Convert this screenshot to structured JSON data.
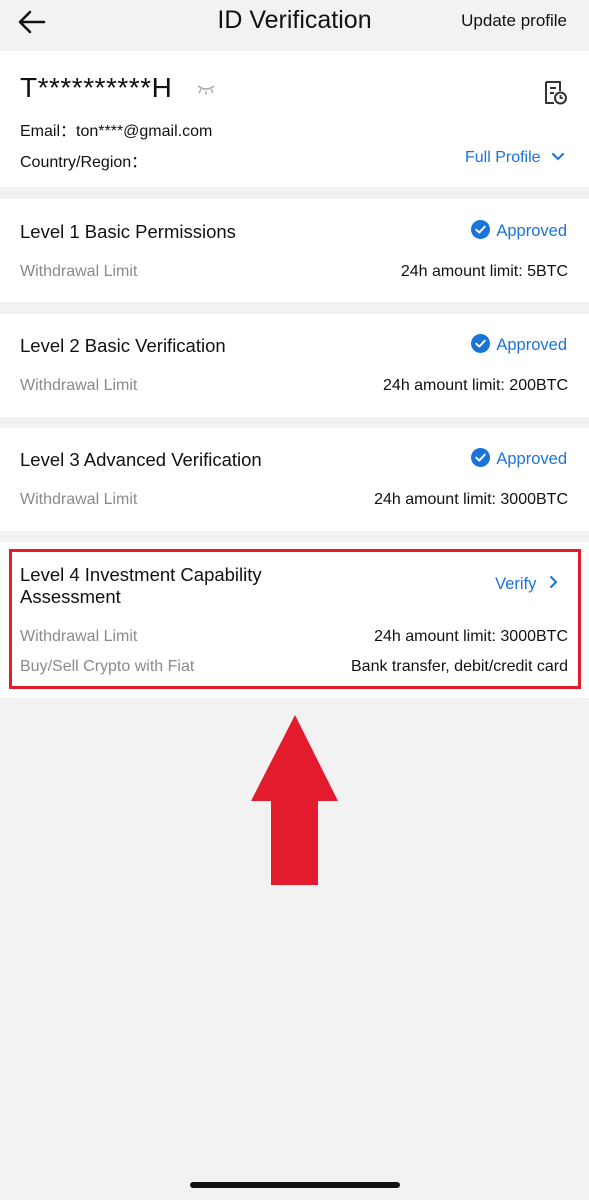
{
  "header": {
    "title": "ID Verification",
    "update_label": "Update profile"
  },
  "profile": {
    "masked_name": "T**********H",
    "email_label": "Email：",
    "email_value": "ton****@gmail.com",
    "country_label": "Country/Region：",
    "full_profile_label": "Full Profile"
  },
  "levels": [
    {
      "title": "Level 1 Basic Permissions",
      "status": "Approved",
      "rows": [
        {
          "label": "Withdrawal Limit",
          "value": "24h amount limit: 5BTC"
        }
      ]
    },
    {
      "title": "Level 2 Basic Verification",
      "status": "Approved",
      "rows": [
        {
          "label": "Withdrawal Limit",
          "value": "24h amount limit: 200BTC"
        }
      ]
    },
    {
      "title": "Level 3 Advanced Verification",
      "status": "Approved",
      "rows": [
        {
          "label": "Withdrawal Limit",
          "value": "24h amount limit: 3000BTC"
        }
      ]
    },
    {
      "title_line1": "Level 4 Investment Capability",
      "title_line2": "Assessment",
      "action": "Verify",
      "rows": [
        {
          "label": "Withdrawal Limit",
          "value": "24h amount limit: 3000BTC"
        },
        {
          "label": "Buy/Sell Crypto with Fiat",
          "value": "Bank transfer, debit/credit card"
        }
      ]
    }
  ],
  "colors": {
    "accent": "#1a73d9",
    "highlight": "#e21c2c",
    "background": "#f2f2f2"
  }
}
